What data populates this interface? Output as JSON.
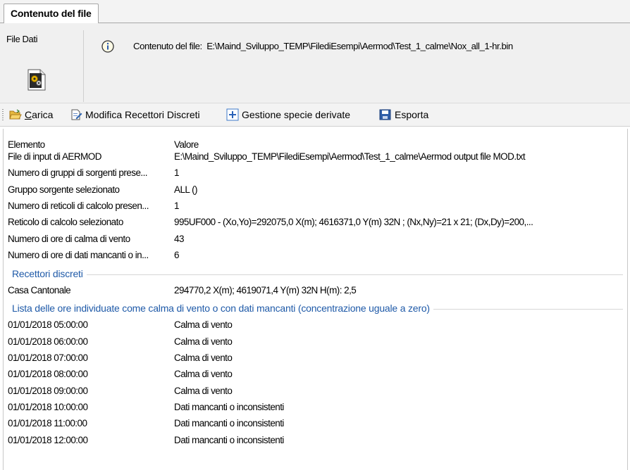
{
  "tab": {
    "label": "Contenuto del file"
  },
  "header": {
    "file_label": "File Dati",
    "info_label": "Contenuto del file:",
    "info_path": "E:\\Maind_Sviluppo_TEMP\\FilediEsempi\\Aermod\\Test_1_calme\\Nox_all_1-hr.bin"
  },
  "toolbar": {
    "carica_prefix": "",
    "carica_underlined": "C",
    "carica_rest": "arica",
    "modifica": "Modifica Recettori Discreti",
    "gestione": "Gestione specie derivate",
    "esporta": "Esporta"
  },
  "grid": {
    "col_elemento": "Elemento",
    "col_valore": "Valore",
    "props": [
      {
        "k": "File di input di AERMOD",
        "v": "E:\\Maind_Sviluppo_TEMP\\FilediEsempi\\Aermod\\Test_1_calme\\Aermod output file MOD.txt"
      },
      {
        "k": "Numero di gruppi di sorgenti prese...",
        "v": "1"
      },
      {
        "k": "Gruppo sorgente selezionato",
        "v": "ALL ()"
      },
      {
        "k": "Numero di reticoli di calcolo presen...",
        "v": "1"
      },
      {
        "k": "Reticolo di calcolo selezionato",
        "v": "995UF000 - (Xo,Yo)=292075,0 X(m); 4616371,0 Y(m) 32N ; (Nx,Ny)=21 x 21; (Dx,Dy)=200,..."
      },
      {
        "k": "Numero di ore di calma di vento",
        "v": "43"
      },
      {
        "k": "Numero di ore di dati mancanti o in...",
        "v": "6"
      }
    ],
    "group_recettori": "Recettori discreti",
    "recettori": [
      {
        "k": "Casa Cantonale",
        "v": "294770,2 X(m); 4619071,4 Y(m) 32N  H(m): 2,5"
      }
    ],
    "group_ore": "Lista delle ore individuate come calma di vento o con dati mancanti (concentrazione uguale a zero)",
    "ore": [
      {
        "k": "01/01/2018 05:00:00",
        "v": "Calma di vento"
      },
      {
        "k": "01/01/2018 06:00:00",
        "v": "Calma di vento"
      },
      {
        "k": "01/01/2018 07:00:00",
        "v": "Calma di vento"
      },
      {
        "k": "01/01/2018 08:00:00",
        "v": "Calma di vento"
      },
      {
        "k": "01/01/2018 09:00:00",
        "v": "Calma di vento"
      },
      {
        "k": "01/01/2018 10:00:00",
        "v": "Dati mancanti o inconsistenti"
      },
      {
        "k": "01/01/2018 11:00:00",
        "v": "Dati mancanti o inconsistenti"
      },
      {
        "k": "01/01/2018 12:00:00",
        "v": "Dati mancanti o inconsistenti"
      }
    ]
  }
}
